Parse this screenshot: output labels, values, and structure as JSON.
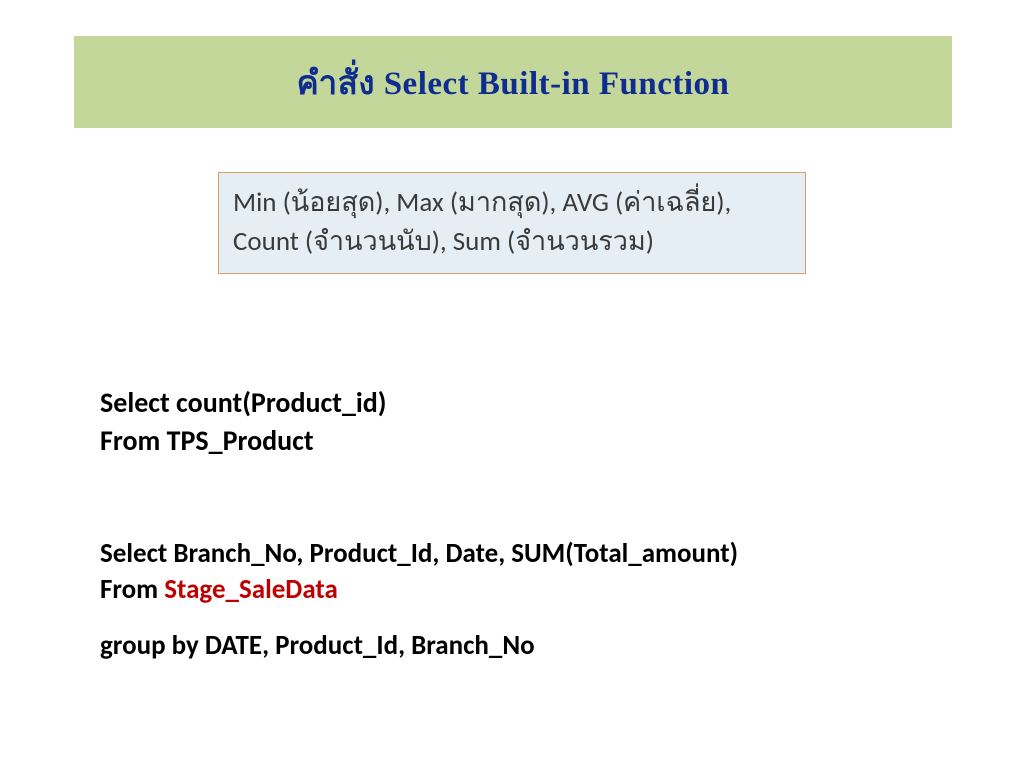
{
  "title": "คำสั่ง Select Built-in Function",
  "info": "Min (น้อยสุด), Max (มากสุด), AVG (ค่าเฉลี่ย), Count (จำนวนนับ), Sum (จำนวนรวม)",
  "query1": {
    "line1": "Select count(Product_id)",
    "line2": "From TPS_Product"
  },
  "query2": {
    "line1_a": "Select Branch_No, Product_Id, Date, SUM(Total_amount)",
    "line2_a": "From ",
    "line2_b": "Stage_SaleData"
  },
  "query3": "group by DATE, Product_Id, Branch_No"
}
